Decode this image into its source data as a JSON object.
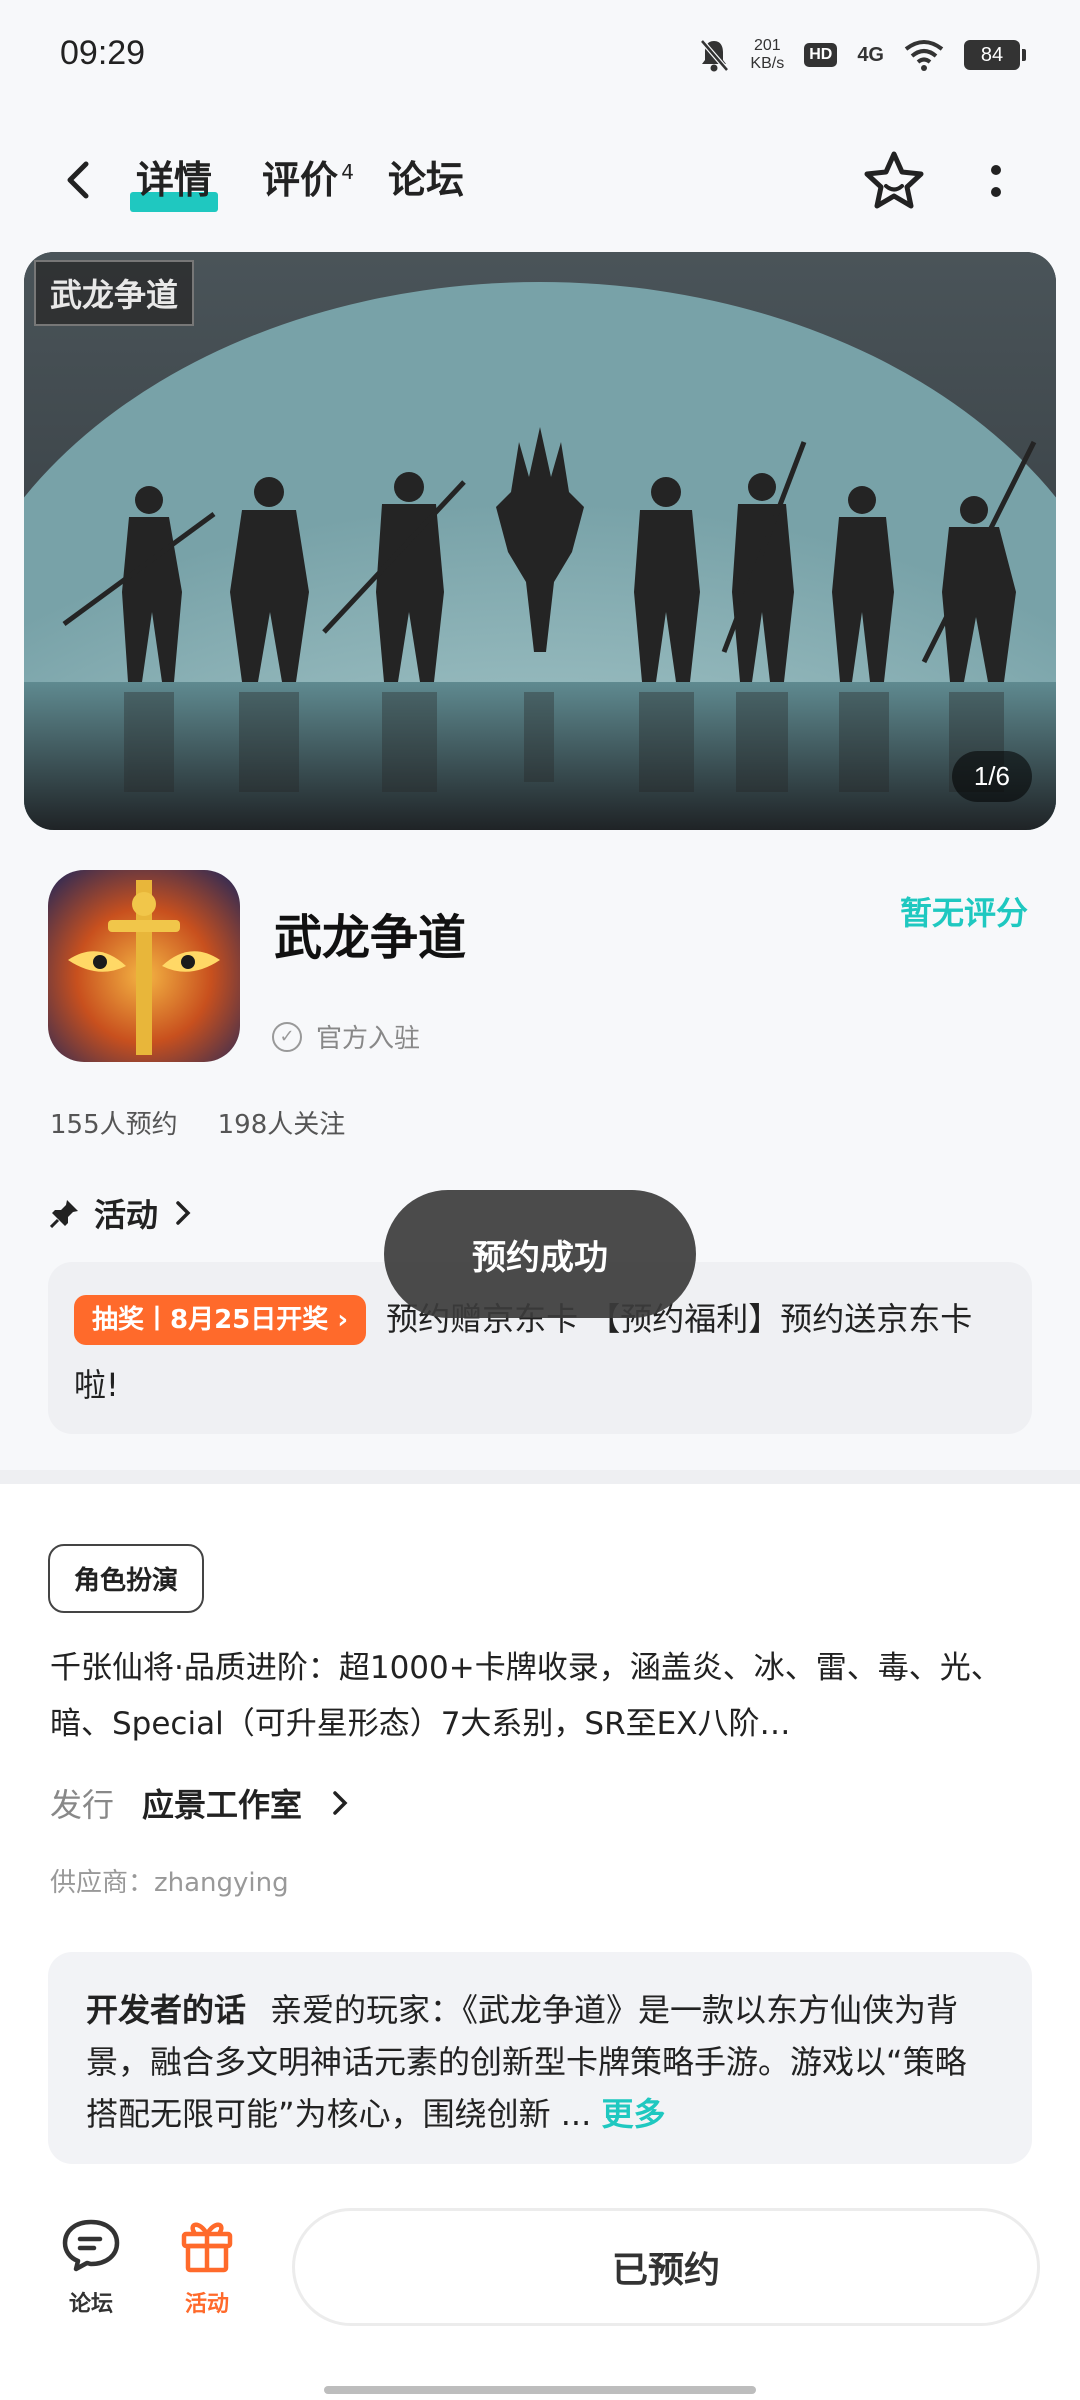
{
  "status_bar": {
    "time": "09:29",
    "speed_value": "201",
    "speed_unit": "KB/s",
    "hd": "HD",
    "network": "4G",
    "battery": "84"
  },
  "header": {
    "tabs": [
      {
        "label": "详情",
        "active": true
      },
      {
        "label": "评价",
        "badge": "4"
      },
      {
        "label": "论坛"
      }
    ]
  },
  "banner": {
    "logo_text": "武龙争道",
    "counter": "1/6"
  },
  "game": {
    "name": "武龙争道",
    "rating": "暂无评分",
    "official": "官方入驻",
    "reservations": "155人预约",
    "followers": "198人关注"
  },
  "activity": {
    "title": "活动",
    "tag": "抽奖丨8月25日开奖",
    "text": "预约赠京东卡 【预约福利】预约送京东卡啦!"
  },
  "toast": "预约成功",
  "details": {
    "genre": "角色扮演",
    "description": "千张仙将·品质进阶：超1000+卡牌收录，涵盖炎、冰、雷、毒、光、暗、Special（可升星形态）7大系别，SR至EX八阶…",
    "publisher_label": "发行",
    "publisher": "应景工作室",
    "supplier": "供应商：zhangying"
  },
  "developer_note": {
    "title": "开发者的话",
    "text": "亲爱的玩家：《武龙争道》是一款以东方仙侠为背景，融合多文明神话元素的创新型卡牌策略手游。游戏以“策略搭配无限可能”为核心，围绕创新 ...",
    "more": "更多"
  },
  "bottom_bar": {
    "forum_label": "论坛",
    "activity_label": "活动",
    "reserve_button": "已预约"
  },
  "colors": {
    "accent": "#1fc8c0",
    "orange": "#ff6a2b"
  }
}
